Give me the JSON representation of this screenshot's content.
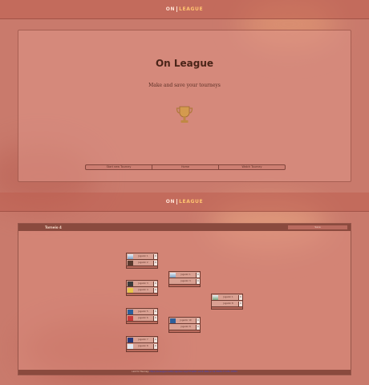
{
  "brand": {
    "on": "ON",
    "league": "LEAGUE"
  },
  "home": {
    "title": "On League",
    "subtitle": "Make and save your tourneys",
    "buttons": [
      "Start new Tourney",
      "Home",
      "Watch Tourney"
    ]
  },
  "tourney": {
    "name": "Torneio 4",
    "save_label": "Save",
    "footer_prefix": "Link for Tourney:",
    "footer_link": "https://onleague.netlify.app/tourney/77f4a8bc-e1c4-4b6e-a7d9-8f1f0c77c2f1-1f3f8d",
    "matches": [
      {
        "p1": "Jogador 1",
        "p2": "Jogador 2",
        "s1": "0",
        "s2": "0"
      },
      {
        "p1": "Jogador 3",
        "p2": "Jogador 4",
        "s1": "0",
        "s2": "0"
      },
      {
        "p1": "Jogador 5",
        "p2": "Jogador 6",
        "s1": "0",
        "s2": "0"
      },
      {
        "p1": "Jogador 7",
        "p2": "Jogador 8",
        "s1": "0",
        "s2": "0"
      },
      {
        "p1": "Jogador 1",
        "p2": "Jogador 3",
        "s1": "0",
        "s2": "0"
      },
      {
        "p1": "Jogador 10",
        "p2": "Jogador 8",
        "s1": "0",
        "s2": "0"
      },
      {
        "p1": "Jogador 1",
        "p2": "Jogador 8",
        "s1": "0",
        "s2": "0"
      }
    ]
  },
  "colors": {
    "accent": "#ffc470",
    "panel_header": "#8a4a3e",
    "background": "#c97a6c"
  },
  "icons": {
    "trophy": "trophy-icon"
  }
}
